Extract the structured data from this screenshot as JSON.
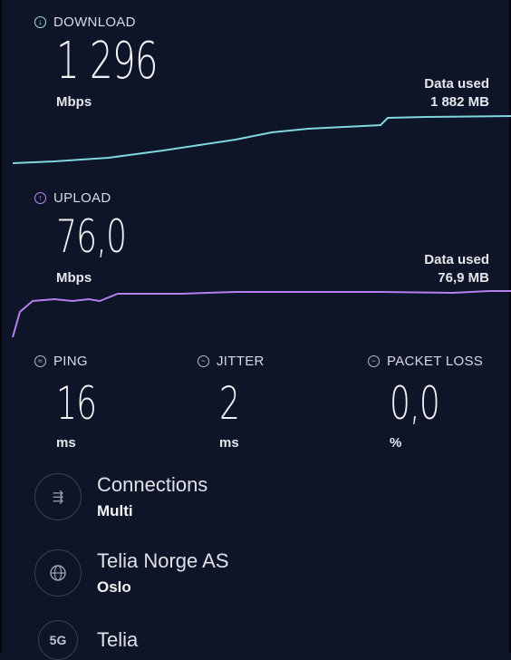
{
  "download": {
    "label": "DOWNLOAD",
    "value": "1 296",
    "unit": "Mbps",
    "data_used_label": "Data used",
    "data_used_value": "1 882 MB",
    "color": "#7fd6dc"
  },
  "upload": {
    "label": "UPLOAD",
    "value": "76,0",
    "unit": "Mbps",
    "data_used_label": "Data used",
    "data_used_value": "76,9 MB",
    "color": "#b57ef0"
  },
  "metrics": {
    "ping": {
      "label": "PING",
      "value": "16",
      "unit": "ms"
    },
    "jitter": {
      "label": "JITTER",
      "value": "2",
      "unit": "ms"
    },
    "packet_loss": {
      "label": "PACKET LOSS",
      "value": "0,0",
      "unit": "%"
    }
  },
  "info": {
    "connections": {
      "icon": "connections-icon",
      "title": "Connections",
      "subtitle": "Multi"
    },
    "provider": {
      "icon": "globe-icon",
      "title": "Telia Norge AS",
      "subtitle": "Oslo"
    },
    "network": {
      "icon_text": "5G",
      "title": "Telia"
    }
  }
}
